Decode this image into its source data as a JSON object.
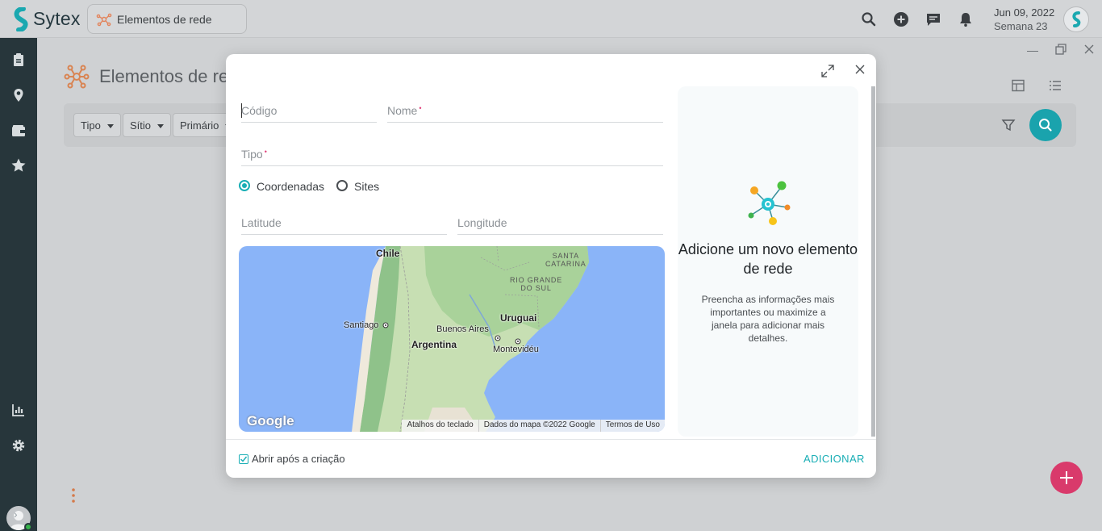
{
  "app": {
    "name": "Sytex"
  },
  "breadcrumb": {
    "label": "Elementos de rede"
  },
  "header": {
    "date": "Jun 09, 2022",
    "week": "Semana 23"
  },
  "page": {
    "title": "Elementos de re",
    "filters": [
      {
        "label": "Tipo"
      },
      {
        "label": "Sítio"
      },
      {
        "label": "Primário"
      }
    ]
  },
  "modal": {
    "fields": {
      "code": "Código",
      "name": "Nome",
      "type": "Tipo",
      "latitude": "Latitude",
      "longitude": "Longitude",
      "required_mark": "•"
    },
    "location_mode": {
      "options": [
        "Coordenadas",
        "Sites"
      ],
      "selected": "Coordenadas"
    },
    "map": {
      "labels": {
        "chile": "Chile",
        "santiago": "Santiago",
        "buenos_aires": "Buenos Aires",
        "argentina": "Argentina",
        "uruguai": "Uruguai",
        "montevideu": "Montevidéu",
        "santa_catarina_1": "SANTA",
        "santa_catarina_2": "CATARINA",
        "rio_grande_1": "RIO GRANDE",
        "rio_grande_2": "DO SUL"
      },
      "logo": "Google",
      "footer": [
        "Atalhos do teclado",
        "Dados do mapa ©2022 Google",
        "Termos de Uso"
      ]
    },
    "info": {
      "title": "Adicione um novo elemento de rede",
      "text": "Preencha as informações mais importantes ou maximize a janela para adicionar mais detalhes."
    },
    "footer": {
      "open_after_create": "Abrir após a criação",
      "open_after_create_checked": true,
      "add_label": "ADICIONAR"
    }
  },
  "colors": {
    "accent": "#19aeb5",
    "fab_add": "#d93a6b",
    "sidebar": "#27363b"
  }
}
